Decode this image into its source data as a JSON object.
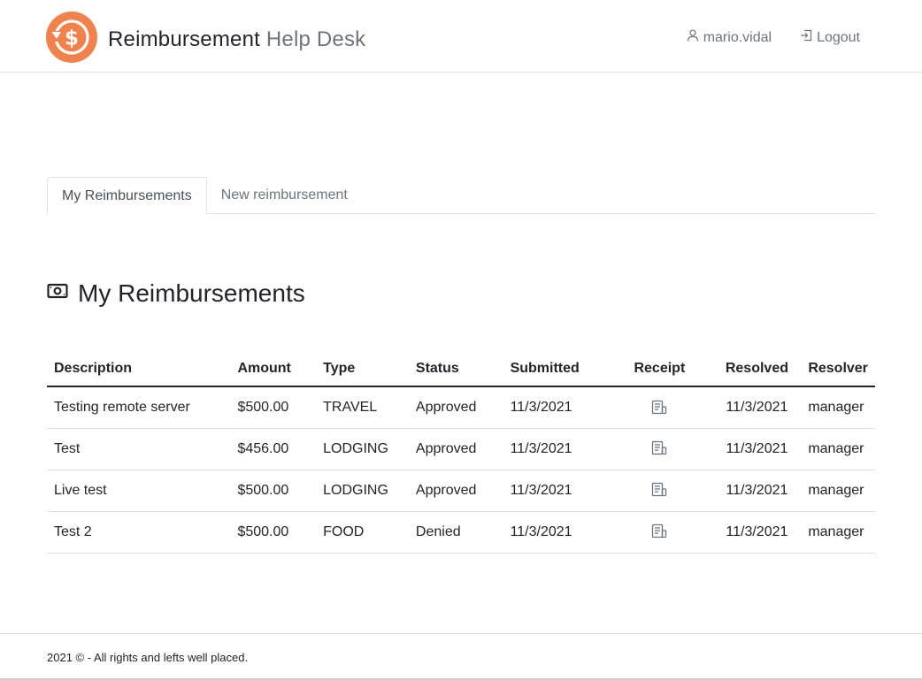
{
  "brand": {
    "primary": "Reimbursement",
    "secondary": "Help Desk",
    "accent_color": "#f0834d"
  },
  "user_nav": {
    "username": "mario.vidal",
    "logout_label": "Logout"
  },
  "tabs": [
    {
      "label": "My Reimbursements",
      "active": true
    },
    {
      "label": "New reimbursement",
      "active": false
    }
  ],
  "section": {
    "title": "My Reimbursements",
    "icon": "cash-icon"
  },
  "table": {
    "headers": [
      "Description",
      "Amount",
      "Type",
      "Status",
      "Submitted",
      "Receipt",
      "Resolved",
      "Resolver"
    ],
    "rows": [
      {
        "description": "Testing remote server",
        "amount": "$500.00",
        "type": "TRAVEL",
        "status": "Approved",
        "submitted": "11/3/2021",
        "receipt": "receipt-icon",
        "resolved": "11/3/2021",
        "resolver": "manager"
      },
      {
        "description": "Test",
        "amount": "$456.00",
        "type": "LODGING",
        "status": "Approved",
        "submitted": "11/3/2021",
        "receipt": "receipt-icon",
        "resolved": "11/3/2021",
        "resolver": "manager"
      },
      {
        "description": "Live test",
        "amount": "$500.00",
        "type": "LODGING",
        "status": "Approved",
        "submitted": "11/3/2021",
        "receipt": "receipt-icon",
        "resolved": "11/3/2021",
        "resolver": "manager"
      },
      {
        "description": "Test 2",
        "amount": "$500.00",
        "type": "FOOD",
        "status": "Denied",
        "submitted": "11/3/2021",
        "receipt": "receipt-icon",
        "resolved": "11/3/2021",
        "resolver": "manager"
      }
    ]
  },
  "footer": {
    "text": "2021 © - All rights and lefts well placed."
  }
}
